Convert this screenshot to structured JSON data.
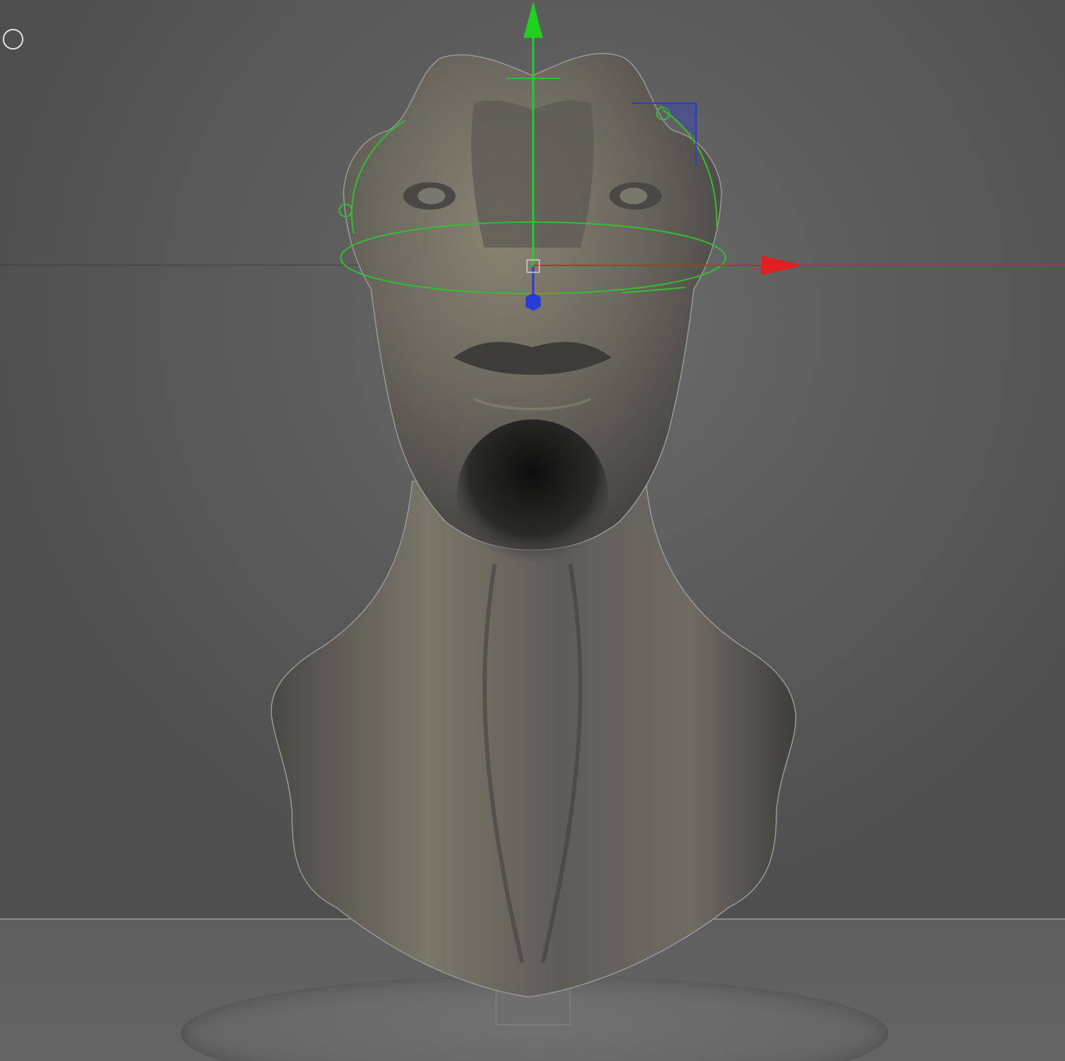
{
  "viewport": {
    "background_color": "#5a5a5a",
    "floor_color": "#626262",
    "model_color": "#5c5b57",
    "model_highlight": "#8a8472"
  },
  "toolbar": {
    "tool_icon": "circle-icon"
  },
  "gizmo": {
    "x_axis_color": "#e02020",
    "y_axis_color": "#20d020",
    "z_axis_color": "#2020e0",
    "rotate_ring_color": "#30c030"
  }
}
